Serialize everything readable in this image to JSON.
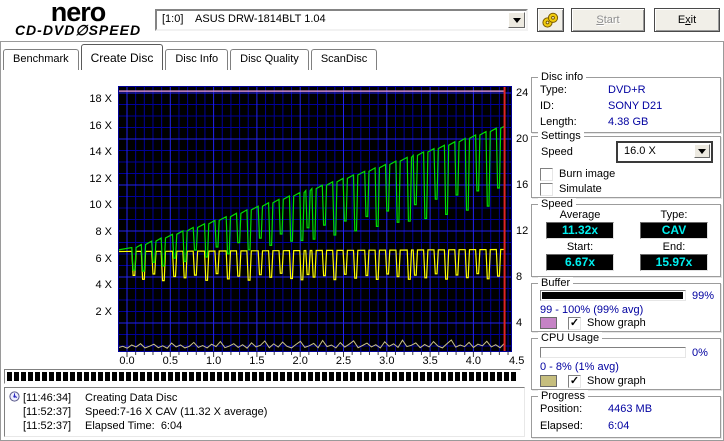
{
  "header": {
    "logo_top": "nero",
    "logo_bottom_left": "CD-DVD",
    "logo_disc_glyph": "∅",
    "logo_bottom_right": "SPEED",
    "drive_select_value": "[1:0]    ASUS DRW-1814BLT 1.04",
    "start_button": {
      "key": "S",
      "rest": "tart",
      "enabled": false
    },
    "exit_button": {
      "pre": "E",
      "key": "x",
      "rest": "it",
      "enabled": true
    }
  },
  "tabs": [
    {
      "label": "Benchmark",
      "active": false
    },
    {
      "label": "Create Disc",
      "active": true
    },
    {
      "label": "Disc Info",
      "active": false
    },
    {
      "label": "Disc Quality",
      "active": false
    },
    {
      "label": "ScanDisc",
      "active": false
    }
  ],
  "chart_data": {
    "type": "line",
    "x_axis": {
      "unit": "GB",
      "tick_labels": [
        "0.0",
        "0.5",
        "1.0",
        "1.5",
        "2.0",
        "2.5",
        "3.0",
        "3.5",
        "4.0",
        "4.5"
      ],
      "min": -0.1,
      "max": 4.45
    },
    "left_axis": {
      "tick_labels": [
        "18 X",
        "16 X",
        "14 X",
        "12 X",
        "10 X",
        "8 X",
        "6 X",
        "4 X",
        "2 X"
      ],
      "unit": "X"
    },
    "right_axis": {
      "tick_labels": [
        "24",
        "20",
        "16",
        "12",
        "8",
        "4"
      ]
    },
    "grid": {
      "bg": "#000000",
      "minor_color": "#000099",
      "major_color": "#2222ee",
      "tick_color": "#404040"
    },
    "position_marker": {
      "x": 4.36,
      "color": "#e02424"
    },
    "series": {
      "write_speed": {
        "color": "#00dd00",
        "trend": {
          "x0": 0,
          "v0": 6.67,
          "x1": 4.36,
          "v1": 15.97
        },
        "spikes": [
          [
            0.08,
            1.7
          ],
          [
            0.19,
            2.0
          ],
          [
            0.31,
            1.6
          ],
          [
            0.42,
            2.1
          ],
          [
            0.55,
            1.8
          ],
          [
            0.67,
            2.3
          ],
          [
            0.79,
            1.7
          ],
          [
            0.92,
            2.5
          ],
          [
            1.04,
            2.0
          ],
          [
            1.17,
            2.8
          ],
          [
            1.29,
            2.2
          ],
          [
            1.41,
            3.0
          ],
          [
            1.54,
            2.4
          ],
          [
            1.66,
            3.2
          ],
          [
            1.78,
            2.6
          ],
          [
            1.9,
            3.4
          ],
          [
            2.02,
            3.6
          ],
          [
            2.09,
            2.8
          ],
          [
            2.16,
            3.8
          ],
          [
            2.28,
            3.0
          ],
          [
            2.4,
            4.0
          ],
          [
            2.52,
            3.2
          ],
          [
            2.64,
            4.2
          ],
          [
            2.77,
            3.4
          ],
          [
            2.89,
            4.4
          ],
          [
            3.01,
            3.5
          ],
          [
            3.13,
            4.6
          ],
          [
            3.26,
            4.8
          ],
          [
            3.33,
            3.7
          ],
          [
            3.45,
            5.0
          ],
          [
            3.57,
            3.8
          ],
          [
            3.69,
            5.2
          ],
          [
            3.81,
            4.0
          ],
          [
            3.93,
            5.4
          ],
          [
            4.05,
            4.2
          ],
          [
            4.17,
            5.6
          ],
          [
            4.29,
            4.5
          ]
        ]
      },
      "secondary_speed": {
        "color": "#ffff00",
        "trend": {
          "x0": 0,
          "v0": 6.55,
          "x1": 4.36,
          "v1": 6.7
        },
        "spikes": [
          [
            0.08,
            1.8
          ],
          [
            0.19,
            2.1
          ],
          [
            0.31,
            1.7
          ],
          [
            0.42,
            2.2
          ],
          [
            0.55,
            1.9
          ],
          [
            0.67,
            2.0
          ],
          [
            0.79,
            1.8
          ],
          [
            0.92,
            2.2
          ],
          [
            1.04,
            1.7
          ],
          [
            1.17,
            2.1
          ],
          [
            1.29,
            1.9
          ],
          [
            1.41,
            2.2
          ],
          [
            1.54,
            1.8
          ],
          [
            1.66,
            2.0
          ],
          [
            1.78,
            1.7
          ],
          [
            1.9,
            2.1
          ],
          [
            2.02,
            2.2
          ],
          [
            2.09,
            1.8
          ],
          [
            2.16,
            2.0
          ],
          [
            2.28,
            1.9
          ],
          [
            2.4,
            2.2
          ],
          [
            2.52,
            1.8
          ],
          [
            2.64,
            2.1
          ],
          [
            2.77,
            1.9
          ],
          [
            2.89,
            2.2
          ],
          [
            3.01,
            1.8
          ],
          [
            3.13,
            2.0
          ],
          [
            3.26,
            2.2
          ],
          [
            3.33,
            1.9
          ],
          [
            3.45,
            2.1
          ],
          [
            3.57,
            1.8
          ],
          [
            3.69,
            2.2
          ],
          [
            3.81,
            1.9
          ],
          [
            3.93,
            2.1
          ],
          [
            4.05,
            1.8
          ],
          [
            4.17,
            2.2
          ],
          [
            4.29,
            2.0
          ]
        ]
      },
      "buffer_level": {
        "color": "#cd8ccd",
        "percent": 99,
        "x_end": 4.36
      },
      "cpu_usage": {
        "color": "#c9c189",
        "percent_values": [
          0.5,
          1,
          0.3,
          1.5,
          0.8,
          2,
          0.4,
          1,
          1.8,
          0.5,
          1.2,
          0.3,
          2.2,
          0.8,
          1.5,
          0.4,
          1,
          2.5,
          0.6,
          1.3,
          0.4,
          1.8,
          0.9,
          2.8,
          0.5,
          1.1,
          2,
          0.6,
          1.6,
          0.3,
          2.3,
          0.8,
          1.4,
          3,
          0.5,
          1.9,
          0.7,
          2.6,
          1,
          0.4,
          1.7,
          2.9,
          0.6,
          1.2,
          2.1,
          0.5,
          3.2,
          0.9,
          1.5,
          0.4,
          2.4,
          0.7,
          1.8,
          3.1,
          0.5,
          1.3,
          2.2,
          0.8,
          1.6,
          0.4,
          2.7,
          1,
          1.9,
          0.6,
          3.3,
          0.9,
          1.4,
          2.3,
          0.5,
          1.7,
          0.8,
          2.8,
          1.1,
          0.4,
          2,
          3.4,
          0.7,
          1.5,
          0.9,
          2.5,
          0.6,
          1.8,
          1.2,
          2.9,
          0.8,
          1.6,
          0.5,
          2.2
        ]
      }
    }
  },
  "progress_strip": {
    "percent": 100
  },
  "log": {
    "rows": [
      {
        "time": "[11:46:34]",
        "text": "Creating Data Disc"
      },
      {
        "time": "[11:52:37]",
        "text": "Speed:7-16 X CAV (11.32 X average)"
      },
      {
        "time": "[11:52:37]",
        "text": "Elapsed Time:  6:04"
      }
    ]
  },
  "panels": {
    "disc_info": {
      "title": "Disc info",
      "rows": [
        {
          "label": "Type:",
          "value": "DVD+R"
        },
        {
          "label": "ID:",
          "value": "SONY D21"
        },
        {
          "label": "Length:",
          "value": "4.38 GB"
        }
      ]
    },
    "settings": {
      "title": "Settings",
      "speed_label": "Speed",
      "speed_value": "16.0 X",
      "burn_image_label": "Burn image",
      "burn_image_checked": false,
      "simulate_label": "Simulate",
      "simulate_checked": false
    },
    "speed": {
      "title": "Speed",
      "average_label": "Average",
      "average_value": "11.32x",
      "type_label": "Type:",
      "type_value": "CAV",
      "start_label": "Start:",
      "start_value": "6.67x",
      "end_label": "End:",
      "end_value": "15.97x",
      "value_text_color": "#00f0f0"
    },
    "buffer": {
      "title": "Buffer",
      "percent": 99,
      "percent_text": "99%",
      "range_text": "99 - 100% (99% avg)",
      "show_graph_label": "Show graph",
      "show_graph_checked": true,
      "swatch_color": "#c583c5"
    },
    "cpu": {
      "title": "CPU Usage",
      "percent": 0,
      "percent_text": "0%",
      "range_text": "0 - 8% (1% avg)",
      "show_graph_label": "Show graph",
      "show_graph_checked": true,
      "swatch_color": "#c6be7e"
    },
    "progress": {
      "title": "Progress",
      "rows": [
        {
          "label": "Position:",
          "value": "4463 MB"
        },
        {
          "label": "Elapsed:",
          "value": "6:04"
        }
      ]
    }
  }
}
